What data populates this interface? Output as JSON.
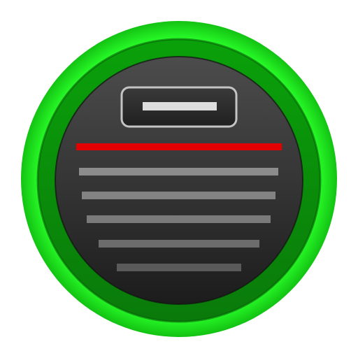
{
  "icon": {
    "name": "document-scanner-app-icon",
    "colors": {
      "outer_ring": "#1fff1f",
      "outer_ring_shadow": "#13c213",
      "inner_ring": "#0a8f0a",
      "inner_ring_dark": "#075f07",
      "face_top": "#4a4a4a",
      "face_bottom": "#1e1e1e",
      "scan_line": "#e40000",
      "text_lines": "#8a8a8a",
      "badge_border": "#bfbfbf",
      "badge_fill": "#2b2b2b",
      "badge_bar": "#dcdcdc"
    }
  }
}
